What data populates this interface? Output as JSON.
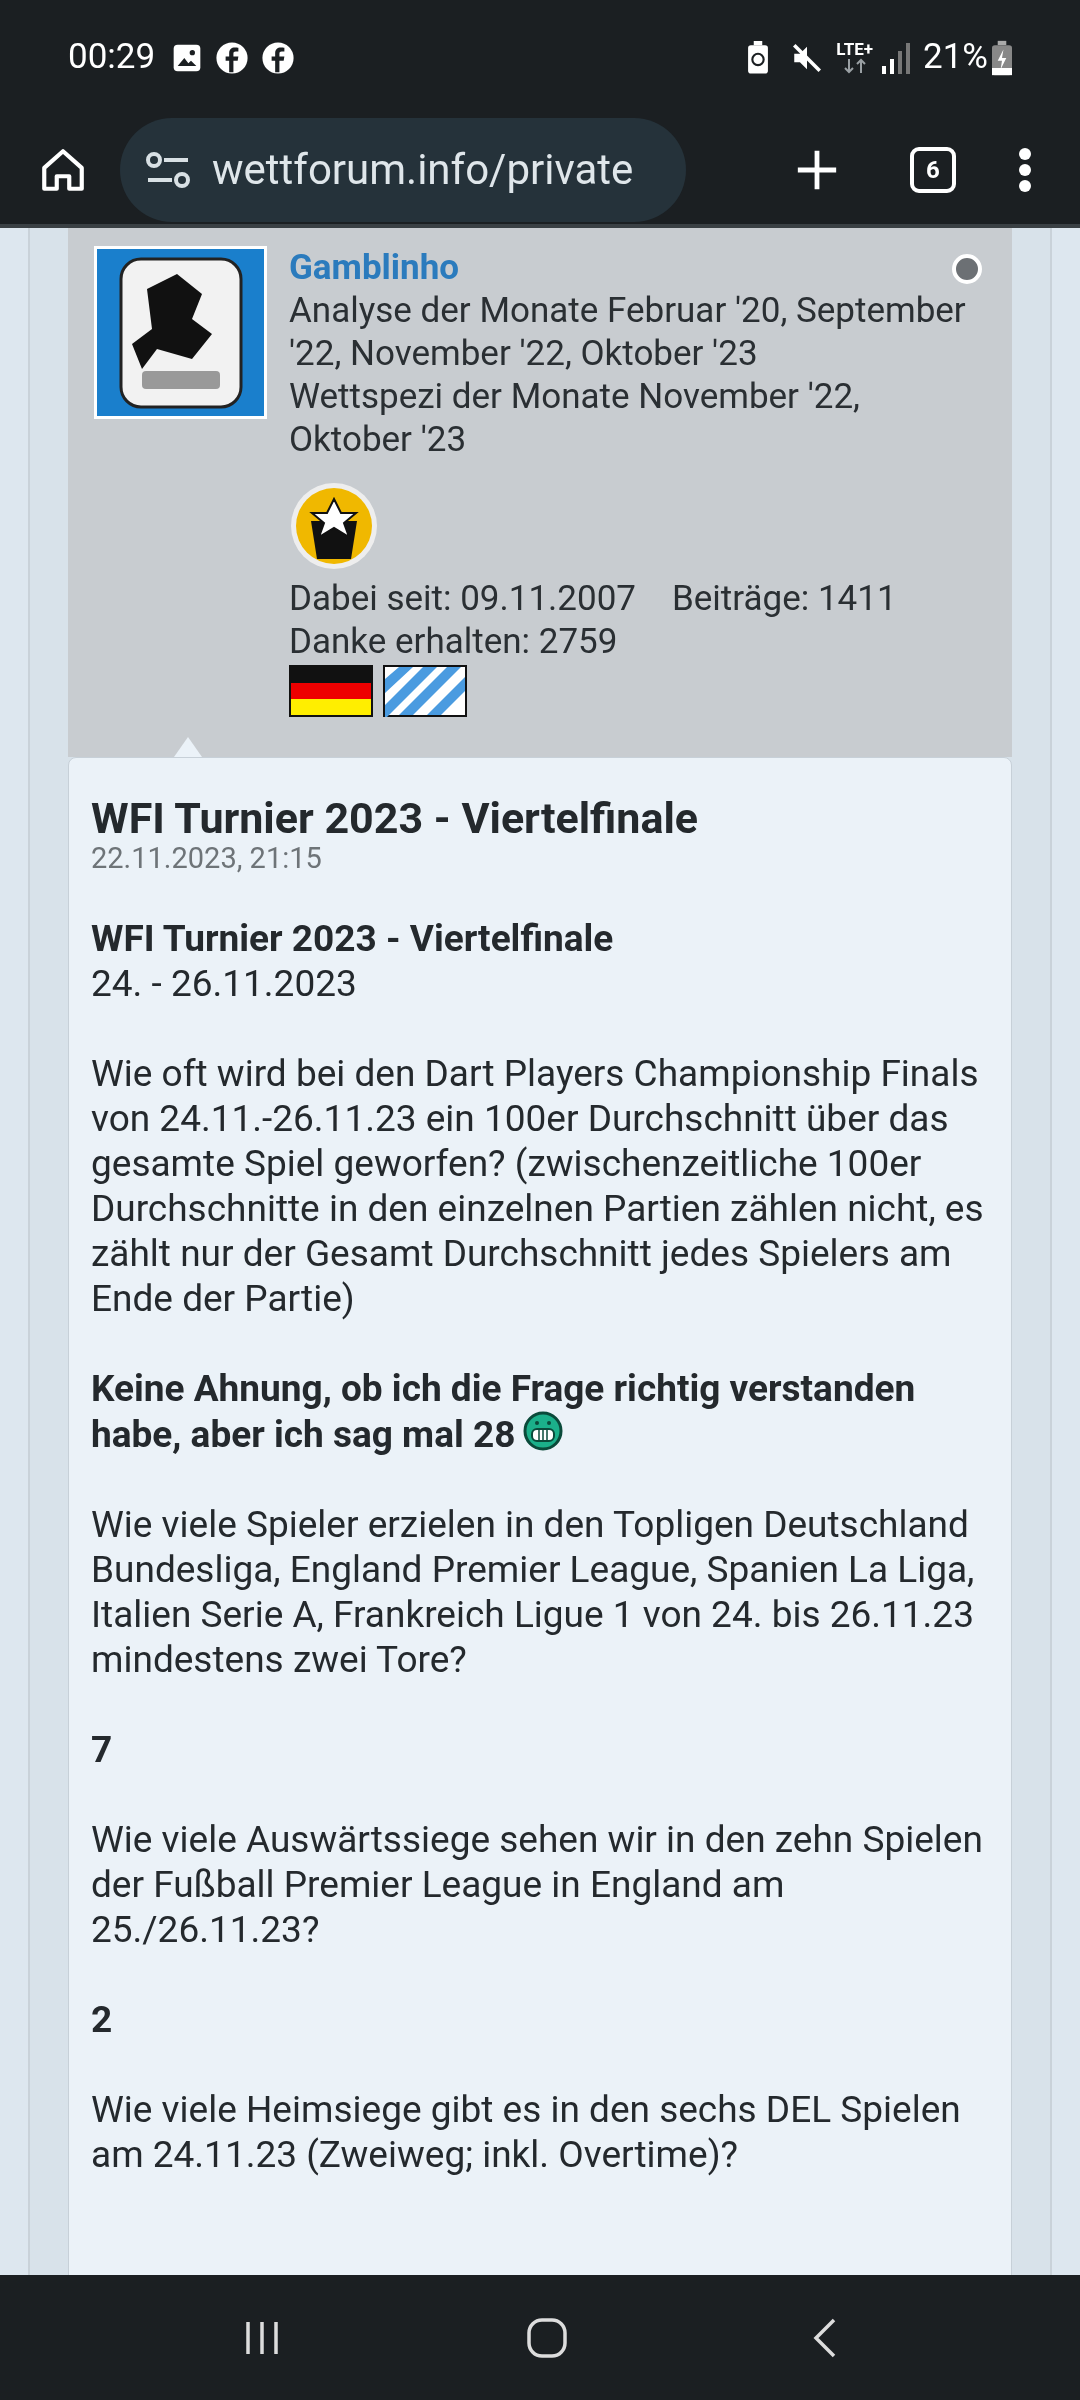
{
  "status_bar": {
    "time": "00:29",
    "network": "LTE+",
    "battery": "21%"
  },
  "browser": {
    "url": "wettforum.info/private",
    "tab_count": "6"
  },
  "user": {
    "name": "Gamblinho",
    "online": false,
    "titles": [
      "Analyse der Monate Februar '20, September '22, November '22, Oktober '23",
      "Wettspezi der Monate November '22, Oktober '23"
    ],
    "since": "Dabei seit: 09.11.2007",
    "posts": "Beiträge: 1411",
    "thanks": "Danke erhalten: 2759"
  },
  "post": {
    "title": "WFI Turnier 2023 - Viertelfinale",
    "date": "22.11.2023, 21:15",
    "heading": "WFI Turnier 2023 - Viertelfinale",
    "subheading": "24. - 26.11.2023",
    "paragraphs": [
      {
        "kind": "text",
        "text": "Wie oft wird bei den Dart Players Championship Finals von 24.11.-26.11.23 ein 100er Durchschnitt über das gesamte Spiel geworfen? (zwischenzeitliche 100er Durchschnitte in den einzelnen Partien zählen nicht, es zählt nur der Gesamt Durchschnitt jedes Spielers am Ende der Partie)"
      },
      {
        "kind": "answer",
        "text": "Keine Ahnung, ob ich die Frage richtig verstanden habe, aber ich sag mal 28",
        "emoji": true
      },
      {
        "kind": "text",
        "text": "Wie viele Spieler erzielen in den Topligen Deutschland Bundesliga, England Premier League, Spanien La Liga, Italien Serie A, Frankreich Ligue 1 von 24. bis 26.11.23 mindestens zwei Tore?"
      },
      {
        "kind": "answer",
        "text": "7",
        "emoji": false
      },
      {
        "kind": "text",
        "text": "Wie viele Auswärtssiege sehen wir in den zehn Spielen der Fußball Premier League in England am 25./26.11.23?"
      },
      {
        "kind": "answer",
        "text": "2",
        "emoji": false
      },
      {
        "kind": "text",
        "text": "Wie viele Heimsiege gibt es in den sechs DEL Spielen am 24.11.23 (Zweiweg; inkl. Overtime)?"
      }
    ]
  }
}
